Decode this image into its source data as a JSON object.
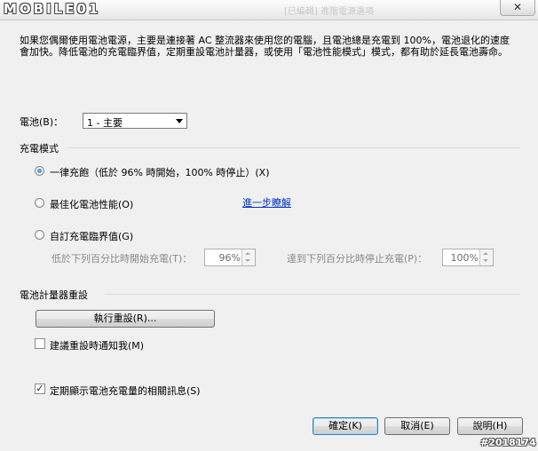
{
  "window": {
    "logo_text": "MOBILE01",
    "ghost_title": "[已編輯] 進階電源選項",
    "close_icon": "close-icon"
  },
  "intro_text": "如果您偶爾使用電池電源，主要是連接著 AC 整流器來使用您的電腦，且電池總是充電到 100%，電池退化的速度會加快。降低電池的充電臨界值，定期重設電池計量器，或使用「電池性能模式」模式，都有助於延長電池壽命。",
  "battery": {
    "label": "電池(B)：",
    "selected": "1 - 主要"
  },
  "charge_mode": {
    "title": "充電模式",
    "options": [
      {
        "label": "一律充飽（低於 96% 時開始，100% 時停止）(X)",
        "checked": true
      },
      {
        "label": "最佳化電池性能(O)",
        "checked": false
      },
      {
        "label": "自訂充電臨界值(G)",
        "checked": false
      }
    ],
    "learn_more": "進一步瞭解",
    "start_label": "低於下列百分比時開始充電(T)：",
    "start_value": "96%",
    "stop_label": "達到下列百分比時停止充電(P)：",
    "stop_value": "100%"
  },
  "gauge_reset": {
    "title": "電池計量器重設",
    "run_button": "執行重設(R)...",
    "notify_label": "建議重設時通知我(M)",
    "notify_checked": false
  },
  "show_info": {
    "label": "定期顯示電池充電量的相關訊息(S)",
    "checked": true
  },
  "footer": {
    "ok": "確定(K)",
    "cancel": "取消(E)",
    "help": "說明(H)"
  },
  "watermark": "#2018174"
}
